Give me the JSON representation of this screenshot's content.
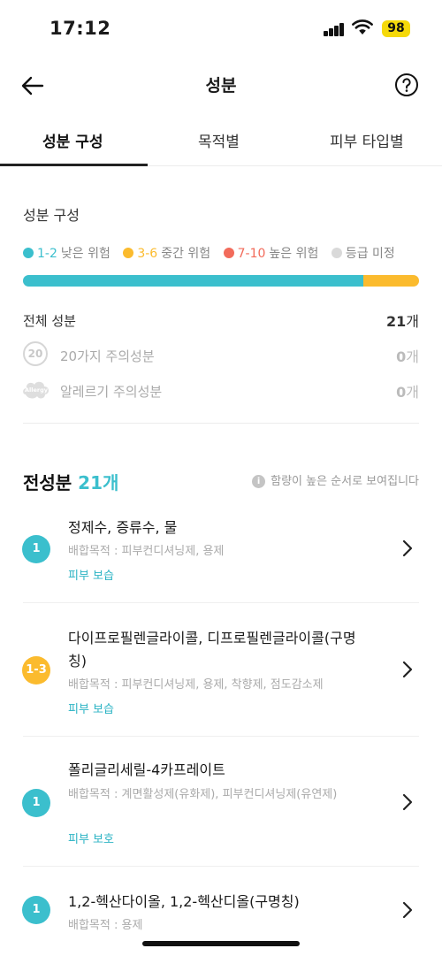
{
  "status_bar": {
    "time": "17:12",
    "battery": "98"
  },
  "nav": {
    "title": "성분"
  },
  "tabs": [
    {
      "label": "성분 구성",
      "active": true
    },
    {
      "label": "목적별",
      "active": false
    },
    {
      "label": "피부 타입별",
      "active": false
    }
  ],
  "composition": {
    "title": "성분 구성",
    "legend": [
      {
        "range": "1-2",
        "label": "낮은 위험",
        "color": "#3bbfcd"
      },
      {
        "range": "3-6",
        "label": "중간 위험",
        "color": "#fbbb2e"
      },
      {
        "range": "7-10",
        "label": "높은 위험",
        "color": "#f26b5b"
      },
      {
        "range": "",
        "label": "등급 미정",
        "color": "#d9d9d9"
      }
    ],
    "bar_fractions": {
      "low": 0.859,
      "mid": 0.141,
      "high": 0,
      "none": 0
    },
    "total": {
      "label": "전체 성분",
      "value": "21",
      "unit": "개"
    },
    "caution20": {
      "icon_text": "20",
      "label": "20가지 주의성분",
      "value": "0",
      "unit": "개"
    },
    "allergy": {
      "icon_text": "Allergy",
      "label": "알레르기 주의성분",
      "value": "0",
      "unit": "개"
    }
  },
  "full_list": {
    "title": "전성분",
    "count": "21개",
    "note": "함량이 높은 순서로 보여집니다",
    "items": [
      {
        "grade": "1",
        "grade_color": "#3bbfcd",
        "name": "정제수, 증류수, 물",
        "purpose": "배합목적 : 피부컨디셔닝제, 용제",
        "tag": "피부 보습"
      },
      {
        "grade": "1-3",
        "grade_color": "#fbbb2e",
        "name": "다이프로필렌글라이콜, 디프로필렌글라이콜(구명칭)",
        "purpose": "배합목적 : 피부컨디셔닝제, 용제, 착향제, 점도감소제",
        "tag": "피부 보습"
      },
      {
        "grade": "1",
        "grade_color": "#3bbfcd",
        "name": "폴리글리세릴-4카프레이트",
        "purpose": "배합목적 : 계면활성제(유화제), 피부컨디셔닝제(유연제)",
        "tag": "피부 보호"
      },
      {
        "grade": "1",
        "grade_color": "#3bbfcd",
        "name": "1,2-헥산다이올, 1,2-헥산디올(구명칭)",
        "purpose": "배합목적 : 용제",
        "tag": ""
      }
    ]
  }
}
